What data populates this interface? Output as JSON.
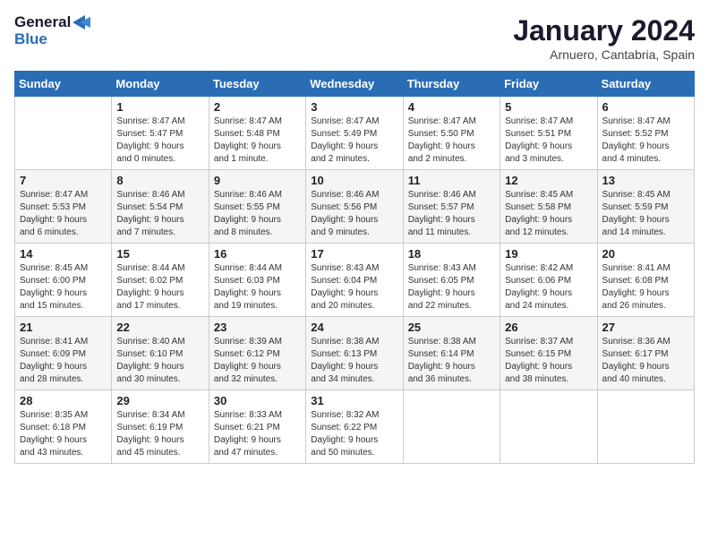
{
  "header": {
    "logo_line1": "General",
    "logo_line2": "Blue",
    "month": "January 2024",
    "location": "Arnuero, Cantabria, Spain"
  },
  "weekdays": [
    "Sunday",
    "Monday",
    "Tuesday",
    "Wednesday",
    "Thursday",
    "Friday",
    "Saturday"
  ],
  "weeks": [
    [
      {
        "day": "",
        "info": ""
      },
      {
        "day": "1",
        "info": "Sunrise: 8:47 AM\nSunset: 5:47 PM\nDaylight: 9 hours\nand 0 minutes."
      },
      {
        "day": "2",
        "info": "Sunrise: 8:47 AM\nSunset: 5:48 PM\nDaylight: 9 hours\nand 1 minute."
      },
      {
        "day": "3",
        "info": "Sunrise: 8:47 AM\nSunset: 5:49 PM\nDaylight: 9 hours\nand 2 minutes."
      },
      {
        "day": "4",
        "info": "Sunrise: 8:47 AM\nSunset: 5:50 PM\nDaylight: 9 hours\nand 2 minutes."
      },
      {
        "day": "5",
        "info": "Sunrise: 8:47 AM\nSunset: 5:51 PM\nDaylight: 9 hours\nand 3 minutes."
      },
      {
        "day": "6",
        "info": "Sunrise: 8:47 AM\nSunset: 5:52 PM\nDaylight: 9 hours\nand 4 minutes."
      }
    ],
    [
      {
        "day": "7",
        "info": "Sunrise: 8:47 AM\nSunset: 5:53 PM\nDaylight: 9 hours\nand 6 minutes."
      },
      {
        "day": "8",
        "info": "Sunrise: 8:46 AM\nSunset: 5:54 PM\nDaylight: 9 hours\nand 7 minutes."
      },
      {
        "day": "9",
        "info": "Sunrise: 8:46 AM\nSunset: 5:55 PM\nDaylight: 9 hours\nand 8 minutes."
      },
      {
        "day": "10",
        "info": "Sunrise: 8:46 AM\nSunset: 5:56 PM\nDaylight: 9 hours\nand 9 minutes."
      },
      {
        "day": "11",
        "info": "Sunrise: 8:46 AM\nSunset: 5:57 PM\nDaylight: 9 hours\nand 11 minutes."
      },
      {
        "day": "12",
        "info": "Sunrise: 8:45 AM\nSunset: 5:58 PM\nDaylight: 9 hours\nand 12 minutes."
      },
      {
        "day": "13",
        "info": "Sunrise: 8:45 AM\nSunset: 5:59 PM\nDaylight: 9 hours\nand 14 minutes."
      }
    ],
    [
      {
        "day": "14",
        "info": "Sunrise: 8:45 AM\nSunset: 6:00 PM\nDaylight: 9 hours\nand 15 minutes."
      },
      {
        "day": "15",
        "info": "Sunrise: 8:44 AM\nSunset: 6:02 PM\nDaylight: 9 hours\nand 17 minutes."
      },
      {
        "day": "16",
        "info": "Sunrise: 8:44 AM\nSunset: 6:03 PM\nDaylight: 9 hours\nand 19 minutes."
      },
      {
        "day": "17",
        "info": "Sunrise: 8:43 AM\nSunset: 6:04 PM\nDaylight: 9 hours\nand 20 minutes."
      },
      {
        "day": "18",
        "info": "Sunrise: 8:43 AM\nSunset: 6:05 PM\nDaylight: 9 hours\nand 22 minutes."
      },
      {
        "day": "19",
        "info": "Sunrise: 8:42 AM\nSunset: 6:06 PM\nDaylight: 9 hours\nand 24 minutes."
      },
      {
        "day": "20",
        "info": "Sunrise: 8:41 AM\nSunset: 6:08 PM\nDaylight: 9 hours\nand 26 minutes."
      }
    ],
    [
      {
        "day": "21",
        "info": "Sunrise: 8:41 AM\nSunset: 6:09 PM\nDaylight: 9 hours\nand 28 minutes."
      },
      {
        "day": "22",
        "info": "Sunrise: 8:40 AM\nSunset: 6:10 PM\nDaylight: 9 hours\nand 30 minutes."
      },
      {
        "day": "23",
        "info": "Sunrise: 8:39 AM\nSunset: 6:12 PM\nDaylight: 9 hours\nand 32 minutes."
      },
      {
        "day": "24",
        "info": "Sunrise: 8:38 AM\nSunset: 6:13 PM\nDaylight: 9 hours\nand 34 minutes."
      },
      {
        "day": "25",
        "info": "Sunrise: 8:38 AM\nSunset: 6:14 PM\nDaylight: 9 hours\nand 36 minutes."
      },
      {
        "day": "26",
        "info": "Sunrise: 8:37 AM\nSunset: 6:15 PM\nDaylight: 9 hours\nand 38 minutes."
      },
      {
        "day": "27",
        "info": "Sunrise: 8:36 AM\nSunset: 6:17 PM\nDaylight: 9 hours\nand 40 minutes."
      }
    ],
    [
      {
        "day": "28",
        "info": "Sunrise: 8:35 AM\nSunset: 6:18 PM\nDaylight: 9 hours\nand 43 minutes."
      },
      {
        "day": "29",
        "info": "Sunrise: 8:34 AM\nSunset: 6:19 PM\nDaylight: 9 hours\nand 45 minutes."
      },
      {
        "day": "30",
        "info": "Sunrise: 8:33 AM\nSunset: 6:21 PM\nDaylight: 9 hours\nand 47 minutes."
      },
      {
        "day": "31",
        "info": "Sunrise: 8:32 AM\nSunset: 6:22 PM\nDaylight: 9 hours\nand 50 minutes."
      },
      {
        "day": "",
        "info": ""
      },
      {
        "day": "",
        "info": ""
      },
      {
        "day": "",
        "info": ""
      }
    ]
  ]
}
